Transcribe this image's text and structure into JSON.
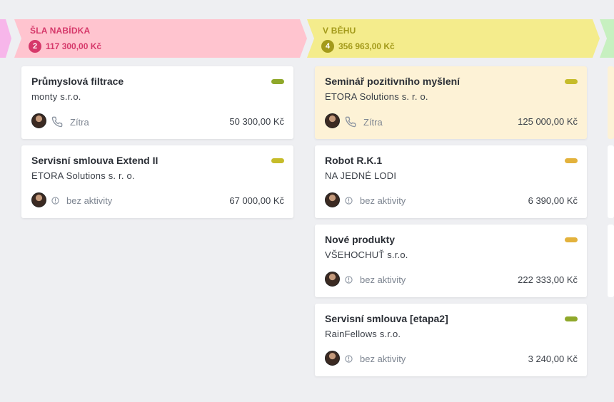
{
  "stages": [
    {
      "id": "offer",
      "title": "ŠLA NABÍDKA",
      "count": "2",
      "total": "117 300,00 Kč",
      "colors": {
        "bg": "#ffc4cf",
        "text": "#d6386a",
        "badge": "#d6386a"
      },
      "cards": [
        {
          "title": "Průmyslová filtrace",
          "company": "monty s.r.o.",
          "activity_icon": "phone-icon",
          "activity": "Zítra",
          "amount": "50 300,00 Kč",
          "tag_color": "#8fa82a",
          "highlight": false
        },
        {
          "title": "Servisní smlouva Extend II",
          "company": "ETORA Solutions s. r. o.",
          "activity_icon": "clock-icon",
          "activity": "bez aktivity",
          "amount": "67 000,00 Kč",
          "tag_color": "#c6bc2a",
          "highlight": false
        }
      ]
    },
    {
      "id": "running",
      "title": "V BĚHU",
      "count": "4",
      "total": "356 963,00 Kč",
      "colors": {
        "bg": "#f4ec8c",
        "text": "#a39a1a",
        "badge": "#a39a1a"
      },
      "cards": [
        {
          "title": "Seminář pozitivního myšlení",
          "company": "ETORA Solutions s. r. o.",
          "activity_icon": "phone-icon",
          "activity": "Zítra",
          "amount": "125 000,00 Kč",
          "tag_color": "#c6bc2a",
          "highlight": true
        },
        {
          "title": "Robot R.K.1",
          "company": "NA JEDNÉ LODI",
          "activity_icon": "clock-icon",
          "activity": "bez aktivity",
          "amount": "6 390,00 Kč",
          "tag_color": "#e3b23c",
          "highlight": false
        },
        {
          "title": "Nové produkty",
          "company": "VŠEHOCHUŤ s.r.o.",
          "activity_icon": "clock-icon",
          "activity": "bez aktivity",
          "amount": "222 333,00 Kč",
          "tag_color": "#e3b23c",
          "highlight": false
        },
        {
          "title": "Servisní smlouva [etapa2]",
          "company": "RainFellows s.r.o.",
          "activity_icon": "clock-icon",
          "activity": "bez aktivity",
          "amount": "3 240,00 Kč",
          "tag_color": "#8fa82a",
          "highlight": false
        }
      ]
    }
  ],
  "edge_colors": {
    "left_stage": "#f7b6ea",
    "right_stage": "#c7f0c0",
    "right_card_highlight": "#fdf2d6"
  }
}
